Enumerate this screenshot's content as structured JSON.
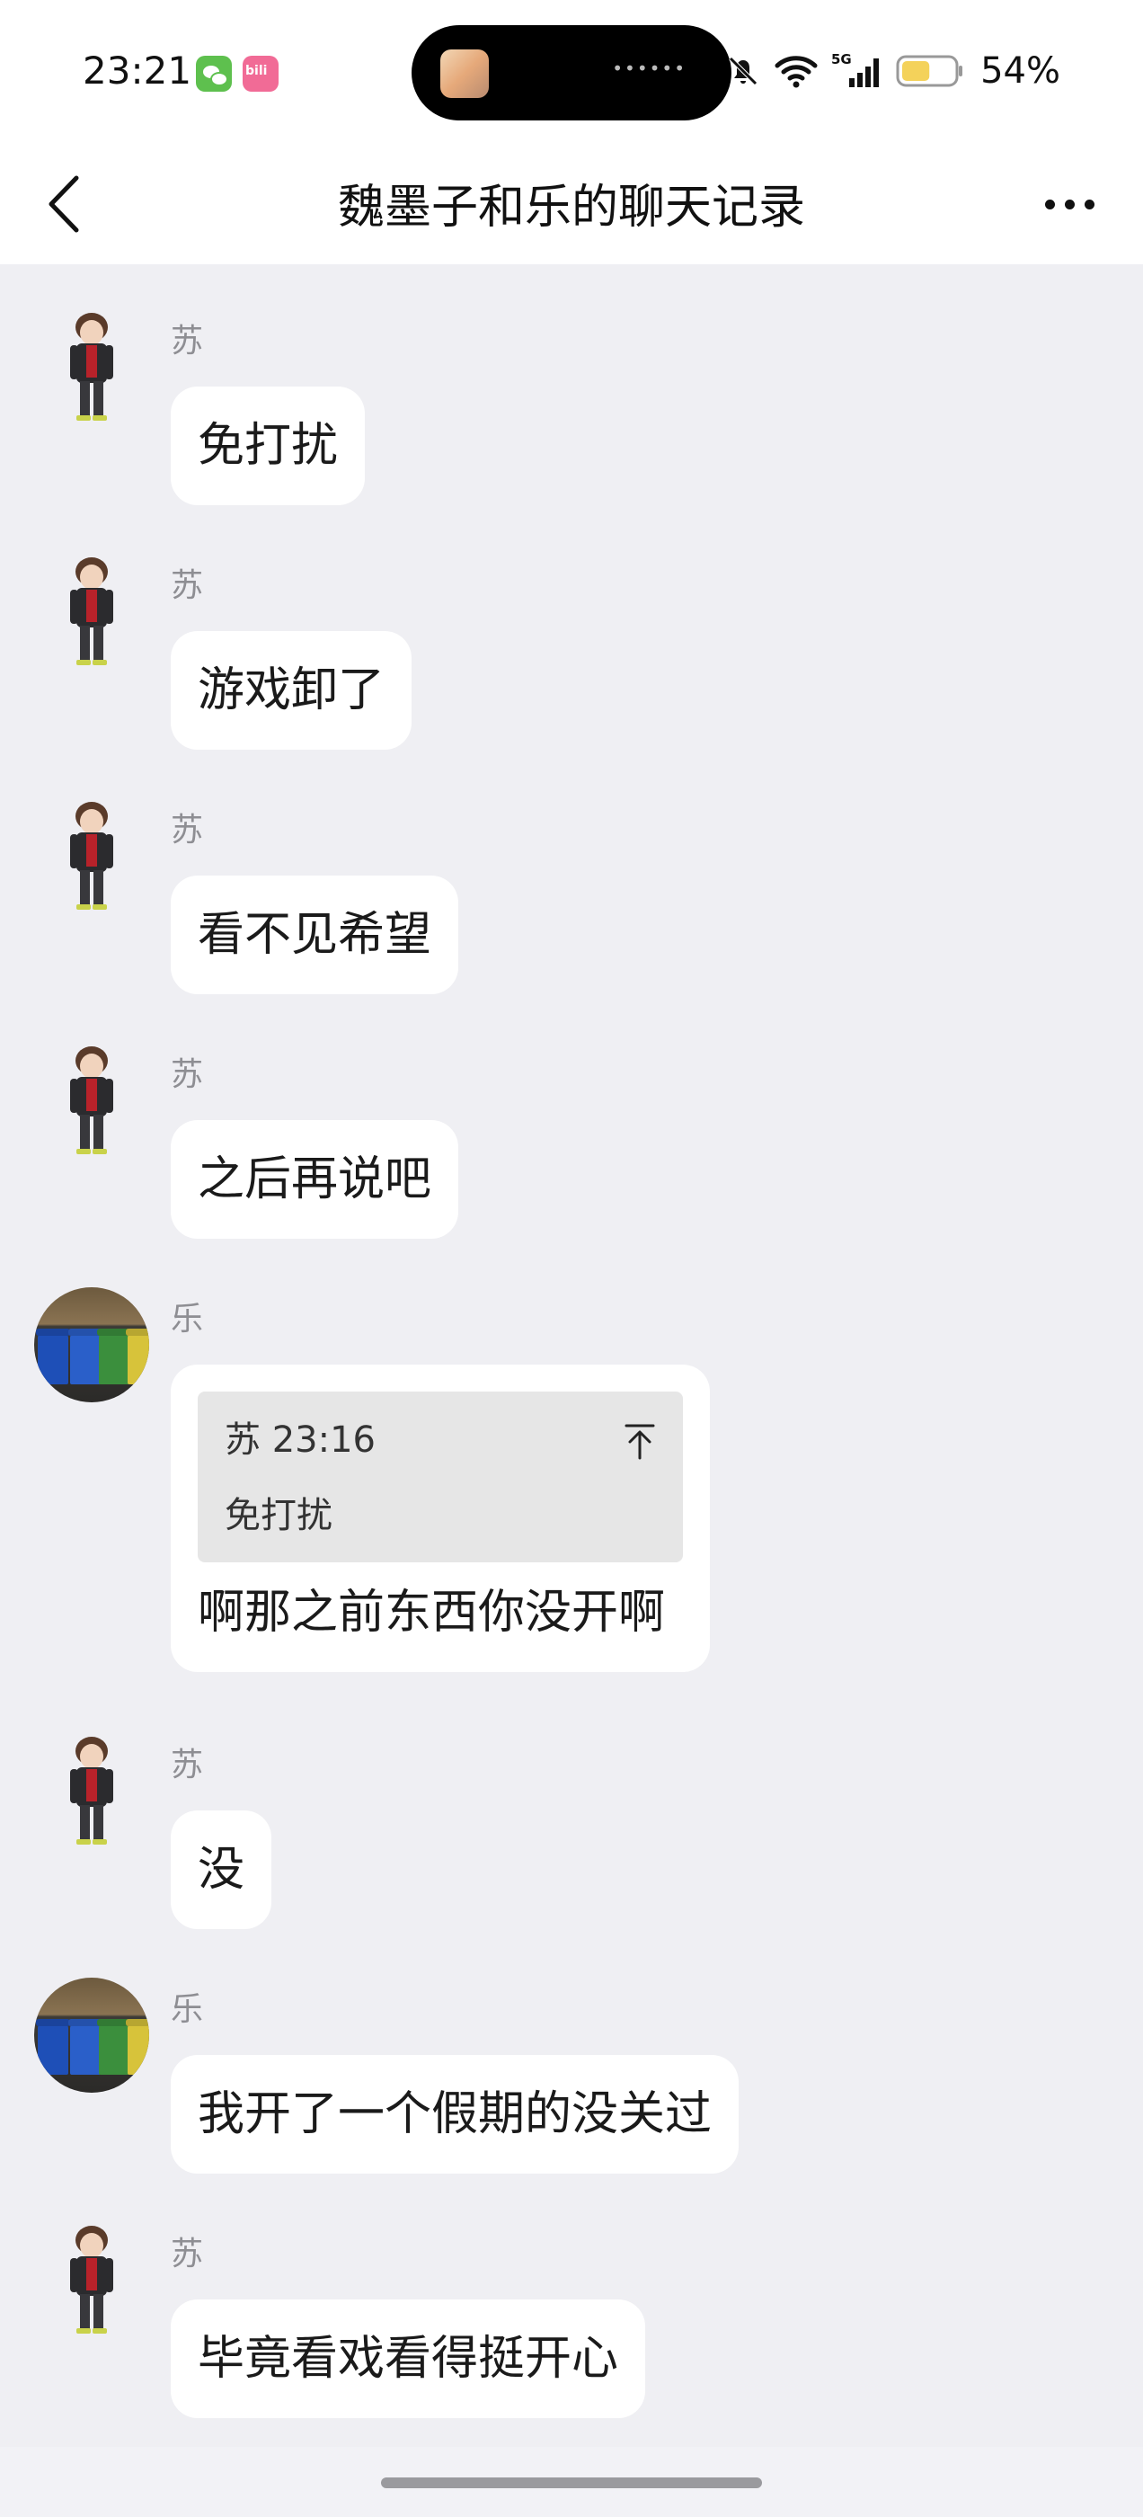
{
  "status_bar": {
    "time": "23:21",
    "battery_percent": "54%",
    "battery_level": 0.54,
    "network": "5G",
    "notification_badges": [
      "wechat-icon",
      "bilibili-icon"
    ]
  },
  "nav": {
    "title": "魏墨子和乐的聊天记录"
  },
  "messages": [
    {
      "sender": "苏",
      "text": "免打扰"
    },
    {
      "sender": "苏",
      "text": "游戏卸了"
    },
    {
      "sender": "苏",
      "text": "看不见希望"
    },
    {
      "sender": "苏",
      "text": "之后再说吧"
    },
    {
      "sender": "乐",
      "quote": {
        "meta": "苏 23:16",
        "text": "免打扰"
      },
      "text": "啊那之前东西你没开啊"
    },
    {
      "sender": "苏",
      "text": "没"
    },
    {
      "sender": "乐",
      "text": "我开了一个假期的没关过"
    },
    {
      "sender": "苏",
      "text": "毕竟看戏看得挺开心"
    }
  ],
  "colors": {
    "chat_background": "#efeff3",
    "bubble": "#ffffff",
    "quote_background": "#e6e6e6",
    "sender_name": "#8e8e93"
  }
}
